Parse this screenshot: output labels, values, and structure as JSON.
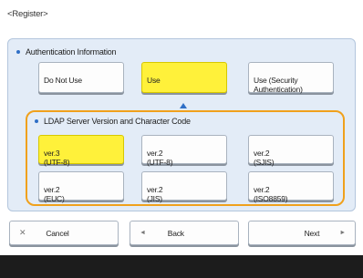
{
  "screen": {
    "title": "<Register>"
  },
  "auth": {
    "section_title": "Authentication Information",
    "options": [
      {
        "label": "Do Not Use",
        "selected": false
      },
      {
        "label": "Use",
        "selected": true
      },
      {
        "label": "Use (Security\nAuthentication)",
        "selected": false
      }
    ]
  },
  "ldap": {
    "section_title": "LDAP Server Version and Character Code",
    "options": [
      {
        "label": "ver.3\n(UTF-8)",
        "selected": true
      },
      {
        "label": "ver.2\n(UTF-8)",
        "selected": false
      },
      {
        "label": "ver.2\n(SJIS)",
        "selected": false
      },
      {
        "label": "ver.2\n(EUC)",
        "selected": false
      },
      {
        "label": "ver.2\n(JIS)",
        "selected": false
      },
      {
        "label": "ver.2\n(ISO8859)",
        "selected": false
      }
    ]
  },
  "footer": {
    "cancel": {
      "label": "Cancel",
      "icon": "close-icon",
      "glyph": "✕"
    },
    "back": {
      "label": "Back",
      "icon": "back-arrow-icon",
      "glyph": "◄"
    },
    "next": {
      "label": "Next",
      "icon": "next-arrow-icon",
      "glyph": "►"
    }
  },
  "colors": {
    "selected": "#fff13a",
    "panel": "#e3ecf7",
    "highlight_border": "#f0a11c",
    "accent": "#2f6fc6"
  }
}
